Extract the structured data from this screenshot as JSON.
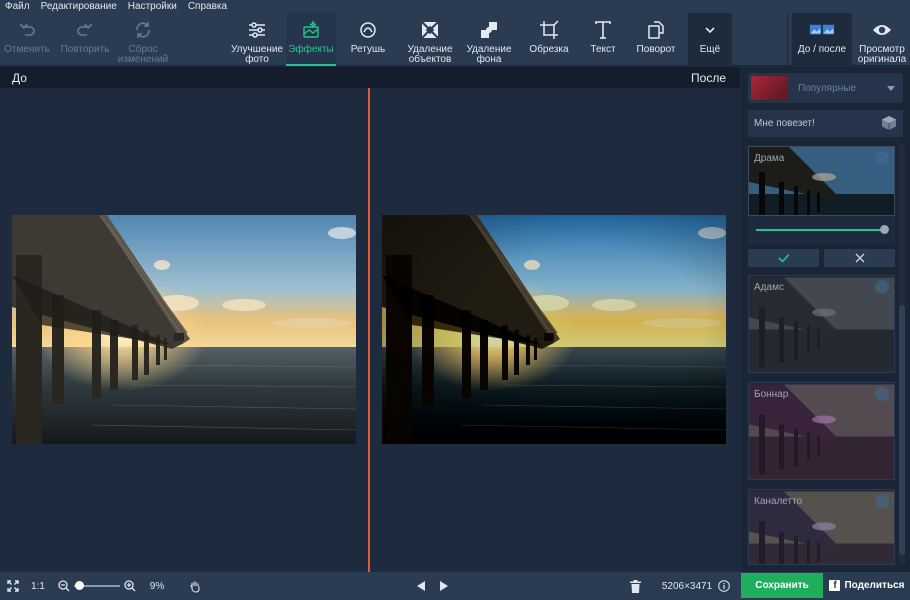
{
  "menu": [
    "Файл",
    "Редактирование",
    "Настройки",
    "Справка"
  ],
  "toolbar": {
    "undo": "Отменить",
    "redo": "Повторить",
    "reset": "Сброс изменений",
    "enhance": "Улучшение фото",
    "effects": "Эффекты",
    "retouch": "Ретушь",
    "remove_objects": "Удаление объектов",
    "remove_bg": "Удаление фона",
    "crop": "Обрезка",
    "text": "Текст",
    "rotate": "Поворот",
    "more": "Ещё",
    "before_after": "До / после",
    "preview_original": "Просмотр оригинала"
  },
  "canvas": {
    "before_label": "До",
    "after_label": "После"
  },
  "panel": {
    "category": "Популярные",
    "lucky": "Мне повезет!",
    "effects": [
      {
        "name": "Драма",
        "selected": true
      },
      {
        "name": "Адамс"
      },
      {
        "name": "Боннар"
      },
      {
        "name": "Каналетто"
      }
    ]
  },
  "bottom": {
    "ratio": "1:1",
    "zoom": "9%",
    "zoom_level": 0.04,
    "dimensions": "5206×3471",
    "save": "Сохранить",
    "share": "Поделиться"
  },
  "colors": {
    "accent": "#27c290",
    "divider": "#e05a3a",
    "save": "#1fae5e"
  }
}
